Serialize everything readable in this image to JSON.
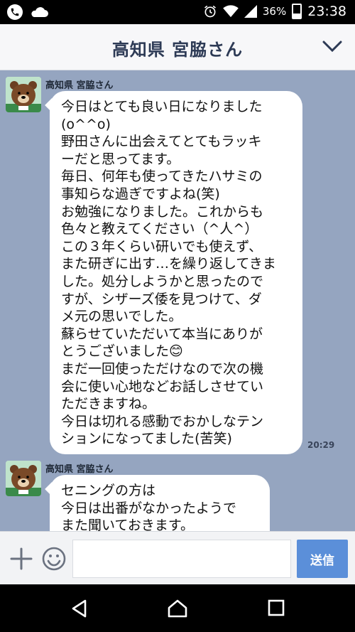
{
  "status_bar": {
    "battery": "36%",
    "time": "23:38"
  },
  "header": {
    "title": "高知県 宮脇さん"
  },
  "messages": [
    {
      "sender": "高知県 宮脇さん",
      "text": "今日はとても良い日になりました\n(o^^o)\n野田さんに出会えてとてもラッキ\nーだと思ってます。\n毎日、何年も使ってきたハサミの\n事知らな過ぎですよね(笑)\nお勉強になりました。これからも\n色々と教えてください（^人^）\nこの３年くらい研いでも使えず、\nまた研ぎに出す…を繰り返してきま\nした。処分しようかと思ったので\nすが、シザーズ倭を見つけて、ダ\nメ元の思いでした。\n蘇らせていただいて本当にありが\nとうございました😊\nまだ一回使っただけなので次の機\n会に使い心地などお話しさせてい\nただきますね。\n今日は切れる感動でおかしなテン\nションになってました(苦笑)",
      "time": "20:29"
    },
    {
      "sender": "高知県 宮脇さん",
      "text": "セニングの方は\n今日は出番がなかったようで\nまた聞いておきます。",
      "time": ""
    }
  ],
  "input": {
    "send_label": "送信",
    "placeholder": ""
  },
  "icons": {
    "status_left": [
      "phone-icon",
      "cloud-icon"
    ],
    "status_right": [
      "alarm-icon",
      "wifi-icon",
      "signal-icon",
      "battery-icon"
    ],
    "header": "chevron-down-icon",
    "input": [
      "plus-icon",
      "emoji-icon"
    ],
    "nav": [
      "back-icon",
      "home-icon",
      "recents-icon"
    ]
  },
  "colors": {
    "chat_background": "#95a5c0",
    "send_button": "#5b8fd9",
    "header_title": "#2d3a55"
  }
}
